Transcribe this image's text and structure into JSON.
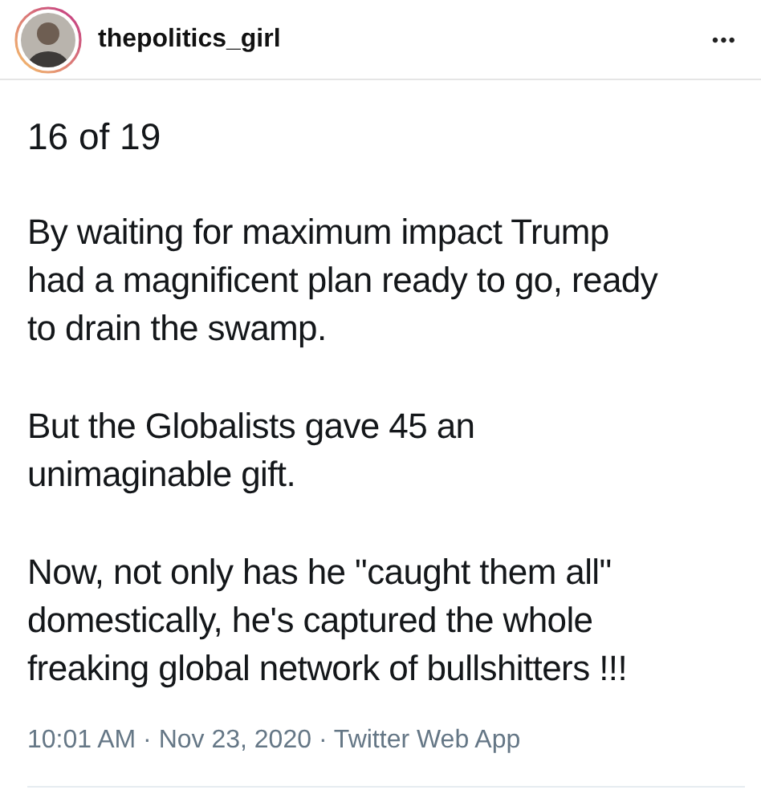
{
  "header": {
    "username": "thepolitics_girl",
    "more": "•••"
  },
  "tweet": {
    "thread_position": "16 of 19",
    "paragraphs": [
      [
        "By waiting for maximum impact Trump",
        "had a magnificent plan ready to go, ready",
        "to drain the swamp."
      ],
      [
        "But the Globalists gave 45 an",
        "unimaginable gift."
      ],
      [
        "Now, not only has he \"caught them all\"",
        "domestically, he's captured the whole",
        "freaking global network of bullshitters !!!"
      ]
    ],
    "timestamp": "10:01 AM · Nov 23, 2020 · Twitter Web App"
  }
}
